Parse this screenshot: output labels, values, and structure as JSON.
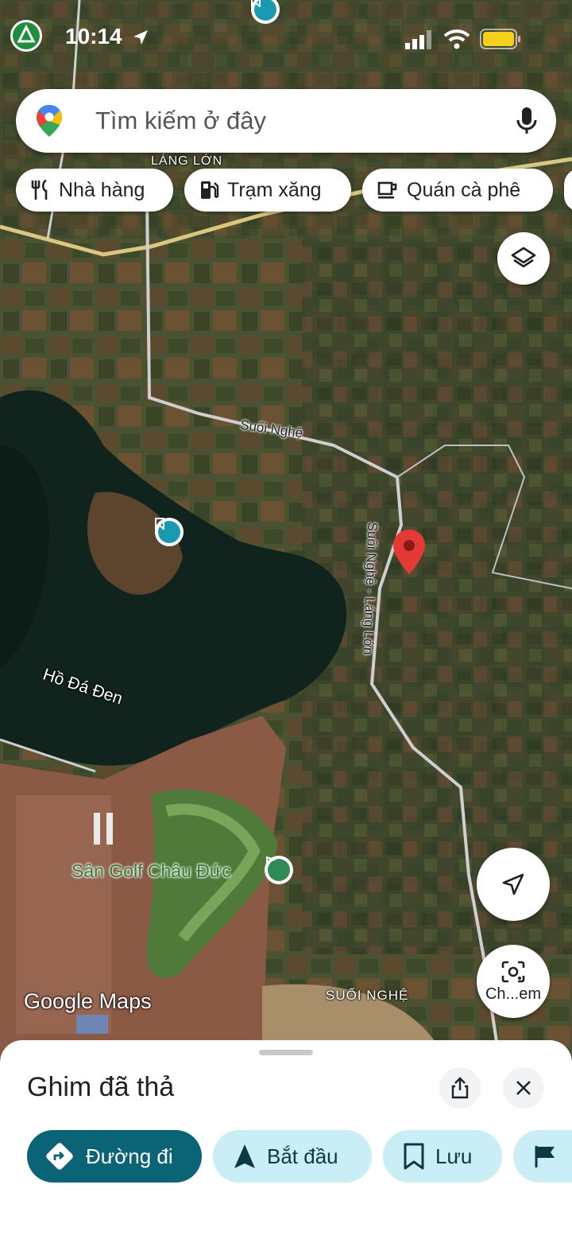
{
  "status_bar": {
    "time": "10:14"
  },
  "search": {
    "placeholder": "Tìm kiếm ở đây"
  },
  "chips": [
    {
      "label": "Nhà hàng",
      "icon": "restaurant-icon"
    },
    {
      "label": "Trạm xăng",
      "icon": "gas-station-icon"
    },
    {
      "label": "Quán cà phê",
      "icon": "cafe-icon"
    }
  ],
  "map": {
    "labels": {
      "lang_lon": "LÁNG LỚN",
      "suoi_nghe_road": "Suối Nghệ",
      "suoi_nghe_lang_lon_road": "Suối Nghệ - Láng Lớn",
      "lake": "Hồ Đá Đen",
      "golf": "Sân Golf Châu Đức",
      "suoi_nghe_area": "SUỐI NGHỆ",
      "watermark": "Google Maps"
    },
    "dropped_pin_color": "#e53935"
  },
  "buttons": {
    "layers_icon": "layers-icon",
    "my_location_icon": "navigation-arrow-icon",
    "lens_label": "Ch...em"
  },
  "sheet": {
    "title": "Ghim đã thả",
    "actions": [
      {
        "label": "Đường đi",
        "icon": "directions-icon"
      },
      {
        "label": "Bắt đầu",
        "icon": "navigation-icon"
      },
      {
        "label": "Lưu",
        "icon": "bookmark-icon"
      },
      {
        "label": "",
        "icon": "flag-icon"
      }
    ]
  },
  "colors": {
    "primary": "#0b6475",
    "secondary": "#c9eef5",
    "poi": "#1a9ab0"
  }
}
